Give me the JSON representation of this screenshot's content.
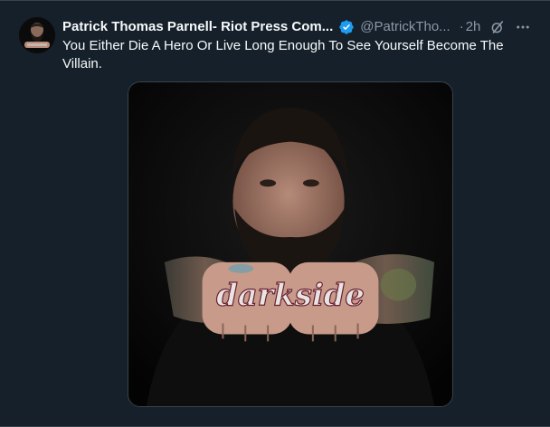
{
  "post": {
    "display_name": "Patrick Thomas Parnell- Riot Press Com...",
    "handle": "@PatrickTho...",
    "separator": "·",
    "time": "2h",
    "text": "You Either Die A Hero Or Live Long Enough To See Yourself Become The Villain.",
    "tattoo_text": "darkside"
  },
  "icons": {
    "verified": "verified-badge-icon",
    "grok": "grok-icon",
    "more": "more-options-icon"
  },
  "colors": {
    "background": "#15202b",
    "text_primary": "#f7f9f9",
    "text_secondary": "#8b98a5",
    "verified": "#1d9bf0",
    "border": "#38444d"
  }
}
